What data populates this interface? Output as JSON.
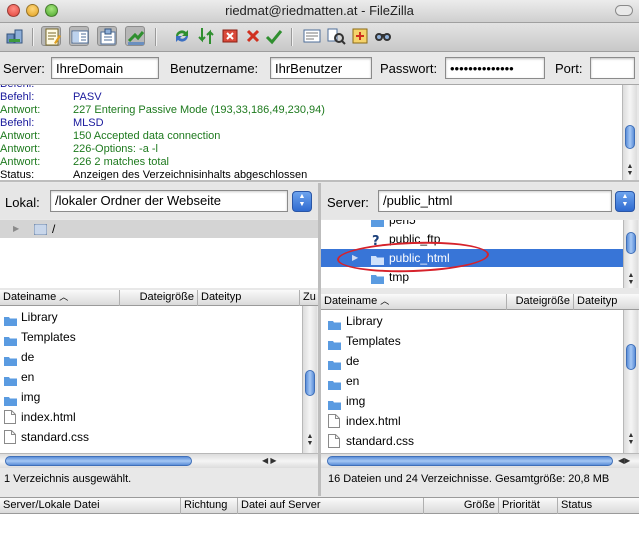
{
  "window": {
    "title": "riedmat@riedmatten.at - FileZilla"
  },
  "toolbar": {
    "icons": [
      "site-manager-icon",
      "log-toggle-icon",
      "tree-toggle-icon",
      "remote-tree-icon",
      "queue-toggle-icon",
      "refresh-icon",
      "process-queue-icon",
      "cancel-icon",
      "disconnect-icon",
      "reconnect-icon",
      "filter-icon",
      "compare-icon",
      "sync-browse-icon",
      "find-icon"
    ]
  },
  "quickconnect": {
    "server_label": "Server:",
    "server_value": "IhreDomain",
    "user_label": "Benutzername:",
    "user_value": "IhrBenutzer",
    "pass_label": "Passwort:",
    "pass_value": "••••••••••••••",
    "port_label": "Port:",
    "port_value": ""
  },
  "log": {
    "rows": [
      {
        "type": "Befehl:",
        "msg": "PASV",
        "color": "#1a1a9c"
      },
      {
        "type": "Antwort:",
        "msg": "227 Entering Passive Mode (193,33,186,49,230,94)",
        "color": "#1e7a1e"
      },
      {
        "type": "Befehl:",
        "msg": "MLSD",
        "color": "#1a1a9c"
      },
      {
        "type": "Antwort:",
        "msg": "150 Accepted data connection",
        "color": "#1e7a1e"
      },
      {
        "type": "Antwort:",
        "msg": "226-Options: -a -l",
        "color": "#1e7a1e"
      },
      {
        "type": "Antwort:",
        "msg": "226 2 matches total",
        "color": "#1e7a1e"
      },
      {
        "type": "Status:",
        "msg": "Anzeigen des Verzeichnisinhalts abgeschlossen",
        "color": "#000000"
      }
    ]
  },
  "local": {
    "label": "Lokal:",
    "path": "/lokaler Ordner der Webseite",
    "tree_root": "/",
    "columns": [
      "Dateiname",
      "Dateigröße",
      "Dateityp",
      "Zu"
    ],
    "files": [
      {
        "name": "Library",
        "kind": "folder"
      },
      {
        "name": "Templates",
        "kind": "folder"
      },
      {
        "name": "de",
        "kind": "folder"
      },
      {
        "name": "en",
        "kind": "folder"
      },
      {
        "name": "img",
        "kind": "folder"
      },
      {
        "name": "index.html",
        "kind": "file"
      },
      {
        "name": "standard.css",
        "kind": "file"
      }
    ],
    "status": "1 Verzeichnis ausgewählt."
  },
  "remote": {
    "label": "Server:",
    "path": "/public_html",
    "tree": [
      {
        "name": "perl5",
        "kind": "folder"
      },
      {
        "name": "public_ftp",
        "kind": "unknown"
      },
      {
        "name": "public_html",
        "kind": "folder",
        "selected": true
      },
      {
        "name": "tmp",
        "kind": "folder"
      }
    ],
    "columns": [
      "Dateiname",
      "Dateigröße",
      "Dateityp"
    ],
    "files": [
      {
        "name": "Library",
        "kind": "folder"
      },
      {
        "name": "Templates",
        "kind": "folder"
      },
      {
        "name": "de",
        "kind": "folder"
      },
      {
        "name": "en",
        "kind": "folder"
      },
      {
        "name": "img",
        "kind": "folder"
      },
      {
        "name": "index.html",
        "kind": "file"
      },
      {
        "name": "standard.css",
        "kind": "file"
      }
    ],
    "status": "16 Dateien und 24 Verzeichnisse. Gesamtgröße: 20,8 MB"
  },
  "queue": {
    "columns": [
      "Server/Lokale Datei",
      "Richtung",
      "Datei auf Server",
      "Größe",
      "Priorität",
      "Status"
    ]
  },
  "colors": {
    "selection": "#3875d7",
    "annotation": "#d6222b",
    "folder": "#5b9be0"
  }
}
